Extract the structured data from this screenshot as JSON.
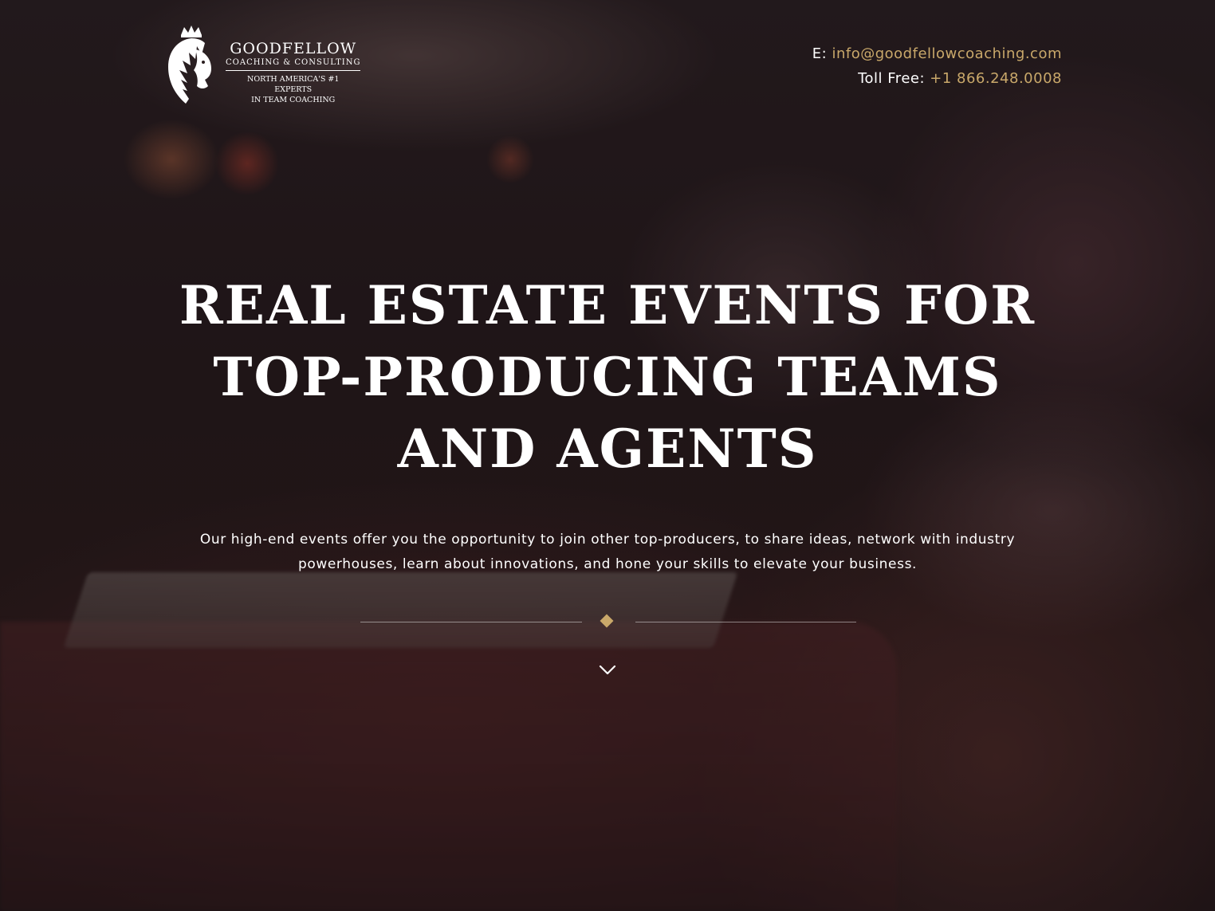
{
  "header": {
    "logo": {
      "brand_name": "GOODFELLOW",
      "brand_sub": "COACHING & CONSULTING",
      "tagline_line1": "NORTH AMERICA'S #1 EXPERTS",
      "tagline_line2": "IN TEAM COACHING"
    },
    "contact": {
      "email_label": "E:",
      "email": "info@goodfellowcoaching.com",
      "phone_label": "Toll Free:",
      "phone": "+1 866.248.0008"
    }
  },
  "hero": {
    "title_line1": "REAL ESTATE EVENTS FOR",
    "title_line2": "TOP-PRODUCING TEAMS",
    "title_line3": "AND AGENTS",
    "description_line1": "Our high-end events offer you the opportunity to join other top-producers, to share ideas, network with industry",
    "description_line2": "powerhouses, learn about innovations, and hone your skills to elevate your business."
  },
  "icons": {
    "logo_mark": "lion-crest-icon",
    "divider": "diamond-icon",
    "scroll": "chevron-down-icon"
  },
  "colors": {
    "accent": "#c9a86a",
    "text": "#ffffff",
    "background": "#25191b"
  }
}
